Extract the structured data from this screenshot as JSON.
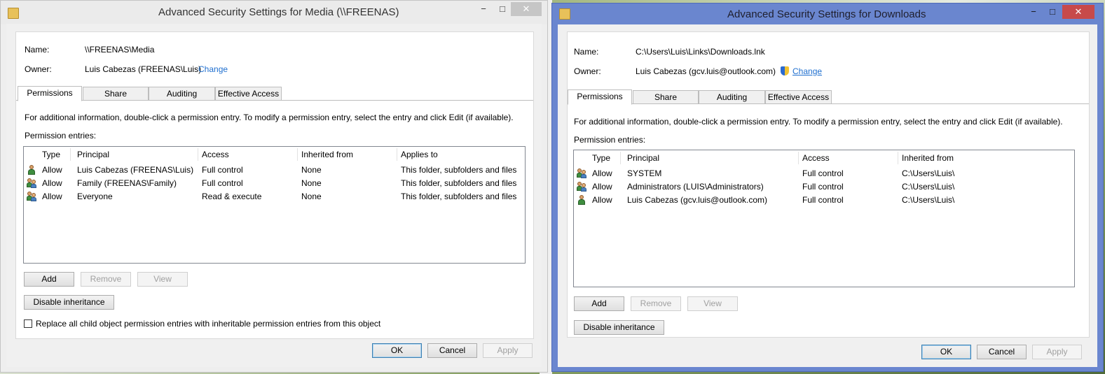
{
  "window1": {
    "title": "Advanced Security Settings for Media (\\\\FREENAS)",
    "controls": {
      "minimize": "−",
      "maximize": "□",
      "close": "✕"
    },
    "name_label": "Name:",
    "name_value": "\\\\FREENAS\\Media",
    "owner_label": "Owner:",
    "owner_value": "Luis Cabezas (FREENAS\\Luis)",
    "change_link": "Change",
    "tabs": [
      "Permissions",
      "Share",
      "Auditing",
      "Effective Access"
    ],
    "info": "For additional information, double-click a permission entry. To modify a permission entry, select the entry and click Edit (if available).",
    "entries_label": "Permission entries:",
    "columns": [
      "Type",
      "Principal",
      "Access",
      "Inherited from",
      "Applies to"
    ],
    "rows": [
      {
        "icon": "user",
        "type": "Allow",
        "principal": "Luis Cabezas (FREENAS\\Luis)",
        "access": "Full control",
        "inherited": "None",
        "applies": "This folder, subfolders and files"
      },
      {
        "icon": "group",
        "type": "Allow",
        "principal": "Family (FREENAS\\Family)",
        "access": "Full control",
        "inherited": "None",
        "applies": "This folder, subfolders and files"
      },
      {
        "icon": "group",
        "type": "Allow",
        "principal": "Everyone",
        "access": "Read & execute",
        "inherited": "None",
        "applies": "This folder, subfolders and files"
      }
    ],
    "add": "Add",
    "remove": "Remove",
    "view": "View",
    "disable_inheritance": "Disable inheritance",
    "replace_checkbox": "Replace all child object permission entries with inheritable permission entries from this object",
    "ok": "OK",
    "cancel": "Cancel",
    "apply": "Apply"
  },
  "window2": {
    "title": "Advanced Security Settings for Downloads",
    "controls": {
      "minimize": "−",
      "maximize": "□",
      "close": "✕"
    },
    "name_label": "Name:",
    "name_value": "C:\\Users\\Luis\\Links\\Downloads.lnk",
    "owner_label": "Owner:",
    "owner_value": "Luis Cabezas (gcv.luis@outlook.com)",
    "change_link": "Change",
    "tabs": [
      "Permissions",
      "Share",
      "Auditing",
      "Effective Access"
    ],
    "info": "For additional information, double-click a permission entry. To modify a permission entry, select the entry and click Edit (if available).",
    "entries_label": "Permission entries:",
    "columns": [
      "Type",
      "Principal",
      "Access",
      "Inherited from"
    ],
    "rows": [
      {
        "icon": "group",
        "type": "Allow",
        "principal": "SYSTEM",
        "access": "Full control",
        "inherited": "C:\\Users\\Luis\\"
      },
      {
        "icon": "group",
        "type": "Allow",
        "principal": "Administrators (LUIS\\Administrators)",
        "access": "Full control",
        "inherited": "C:\\Users\\Luis\\"
      },
      {
        "icon": "user",
        "type": "Allow",
        "principal": "Luis Cabezas (gcv.luis@outlook.com)",
        "access": "Full control",
        "inherited": "C:\\Users\\Luis\\"
      }
    ],
    "add": "Add",
    "remove": "Remove",
    "view": "View",
    "disable_inheritance": "Disable inheritance",
    "ok": "OK",
    "cancel": "Cancel",
    "apply": "Apply"
  }
}
